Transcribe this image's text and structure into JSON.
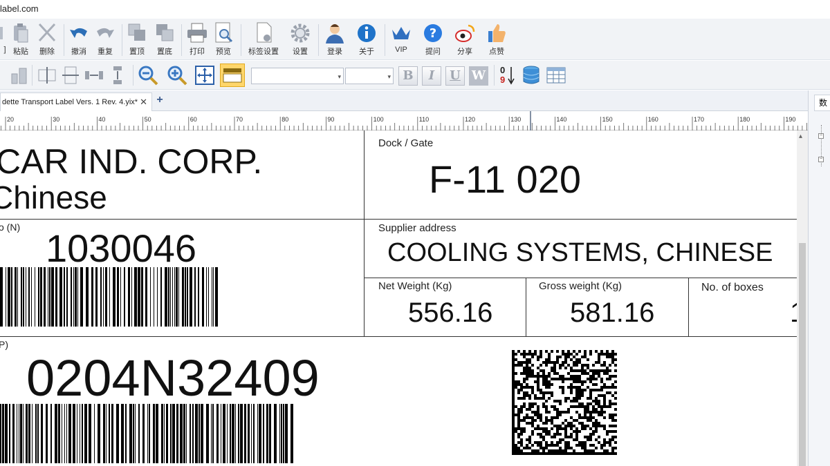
{
  "window": {
    "title": "label.com"
  },
  "toolbar1": [
    {
      "label": "粘贴",
      "icon": "paste-icon"
    },
    {
      "label": "删除",
      "icon": "delete-icon"
    },
    {
      "label": "撤消",
      "icon": "undo-icon"
    },
    {
      "label": "重复",
      "icon": "redo-icon"
    },
    {
      "label": "置顶",
      "icon": "bring-to-front-icon"
    },
    {
      "label": "置底",
      "icon": "send-to-back-icon"
    },
    {
      "label": "打印",
      "icon": "printer-icon"
    },
    {
      "label": "预览",
      "icon": "preview-icon"
    },
    {
      "label": "标签设置",
      "icon": "label-settings-icon"
    },
    {
      "label": "设置",
      "icon": "gear-icon"
    },
    {
      "label": "登录",
      "icon": "user-icon"
    },
    {
      "label": "关于",
      "icon": "info-icon"
    },
    {
      "label": "VIP",
      "icon": "crown-icon"
    },
    {
      "label": "提问",
      "icon": "question-icon"
    },
    {
      "label": "分享",
      "icon": "weibo-icon"
    },
    {
      "label": "点赞",
      "icon": "thumbs-up-icon"
    }
  ],
  "toolbar2": {
    "font_buttons": [
      "B",
      "I",
      "U",
      "W"
    ],
    "sort_top": "0",
    "sort_bottom": "9"
  },
  "tabs": [
    {
      "label": "dette Transport Label Vers. 1 Rev. 4.yix*"
    }
  ],
  "ruler": {
    "ticks": [
      "20",
      "30",
      "40",
      "50",
      "60",
      "70",
      "80",
      "90",
      "100",
      "110",
      "120",
      "130",
      "140",
      "150",
      "160",
      "170",
      "180",
      "190"
    ]
  },
  "right_panel": {
    "header": "数"
  },
  "label": {
    "company_line1": "CAR IND. CORP.",
    "company_line2": "Chinese",
    "dock_caption": "Dock / Gate",
    "dock_value": "F-11 020",
    "part_caption": "o (N)",
    "part_value": "1030046",
    "supplier_caption": "Supplier address",
    "supplier_value": "COOLING SYSTEMS, CHINESE",
    "net_weight_caption": "Net Weight (Kg)",
    "net_weight_value": "556.16",
    "gross_weight_caption": "Gross weight (Kg)",
    "gross_weight_value": "581.16",
    "boxes_caption": "No. of boxes",
    "boxes_value": "1",
    "serial_caption": "P)",
    "serial_value": "0204N32409"
  }
}
